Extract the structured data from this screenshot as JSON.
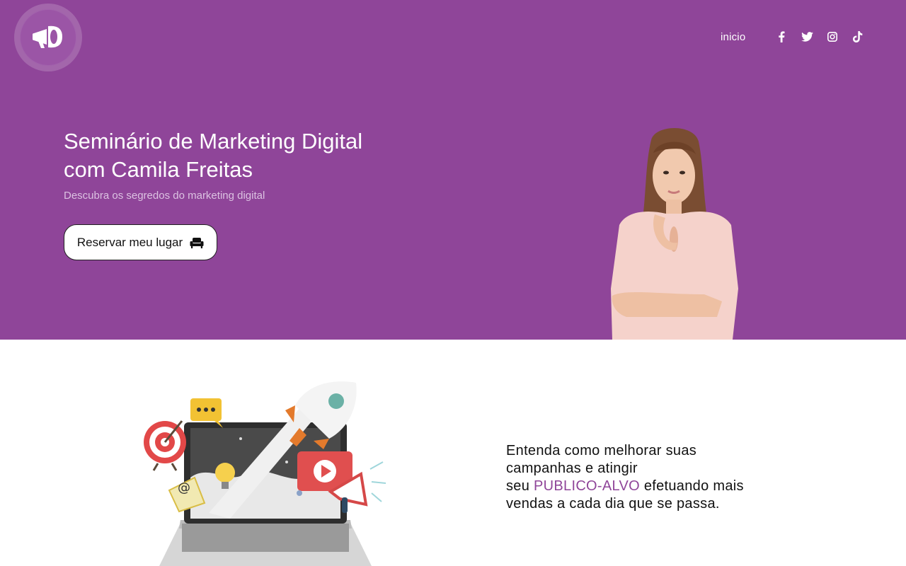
{
  "colors": {
    "brand": "#8f4599",
    "hero_subtitle": "#dcc2e2",
    "text_dark": "#111111"
  },
  "header": {
    "logo_icon": "megaphone-icon",
    "nav": [
      {
        "label": "inicio"
      }
    ],
    "socials": [
      {
        "icon": "facebook-icon"
      },
      {
        "icon": "twitter-icon"
      },
      {
        "icon": "instagram-icon"
      },
      {
        "icon": "tiktok-icon"
      }
    ]
  },
  "hero": {
    "title_line1": "Seminário de Marketing Digital",
    "title_line2": "com Camila Freitas",
    "subtitle": "Descubra os segredos do marketing digital",
    "cta_label": "Reservar meu lugar",
    "cta_icon": "armchair-icon"
  },
  "promo": {
    "line1": "Entenda como melhorar suas",
    "line2": "campanhas e atingir",
    "line3_before": "seu ",
    "line3_highlight": "PUBLICO-ALVO",
    "line3_after": " efetuando mais",
    "line4": "vendas a cada dia que se passa."
  }
}
